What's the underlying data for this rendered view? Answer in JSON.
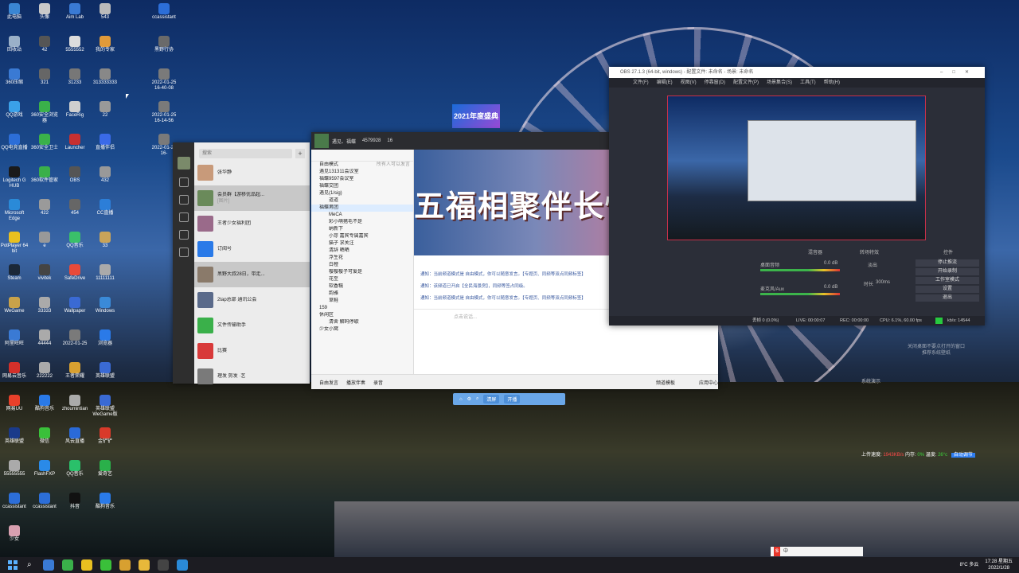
{
  "desktop_icons": [
    {
      "label": "此电脑",
      "color": "#3a86d4"
    },
    {
      "label": "头像",
      "color": "#c9c9c9"
    },
    {
      "label": "Aim Lab",
      "color": "#3a7ad4"
    },
    {
      "label": "543",
      "color": "#bbbbbb"
    },
    {
      "label": "ccassistant",
      "color": "#2c6ed8"
    },
    {
      "label": "回收站",
      "color": "#9ab0c8"
    },
    {
      "label": "42",
      "color": "#555555"
    },
    {
      "label": "5555552",
      "color": "#dddddd"
    },
    {
      "label": "我的专家",
      "color": "#e09a3a"
    },
    {
      "label": "黑野行协",
      "color": "#6a6a6a"
    },
    {
      "label": "360压缩",
      "color": "#3a7ad4"
    },
    {
      "label": "321",
      "color": "#666666"
    },
    {
      "label": "31233",
      "color": "#777777"
    },
    {
      "label": "313333333",
      "color": "#888888"
    },
    {
      "label": "2022-01-25 16-40-08",
      "color": "#7a7a7a"
    },
    {
      "label": "QQ游戏",
      "color": "#3aa0e8"
    },
    {
      "label": "360安全浏览器",
      "color": "#3ab04a"
    },
    {
      "label": "FaceRig",
      "color": "#cfcfcf"
    },
    {
      "label": "22",
      "color": "#999999"
    },
    {
      "label": "2022-01-25 16-14-56",
      "color": "#7a7a7a"
    },
    {
      "label": "QQ电竞直播",
      "color": "#2c6ed8"
    },
    {
      "label": "360安全卫士",
      "color": "#3ab04a"
    },
    {
      "label": "Launcher",
      "color": "#c83030"
    },
    {
      "label": "直播伴侣",
      "color": "#3a6ae8"
    },
    {
      "label": "2022-01-25 16-",
      "color": "#7a7a7a"
    },
    {
      "label": "Logitech G HUB",
      "color": "#1a1a1a"
    },
    {
      "label": "360软件管家",
      "color": "#3ab04a"
    },
    {
      "label": "OBS",
      "color": "#555555"
    },
    {
      "label": "432",
      "color": "#999999"
    },
    {
      "label": "Microsoft Edge",
      "color": "#2a8ad8"
    },
    {
      "label": "422",
      "color": "#9a9a9a"
    },
    {
      "label": "454",
      "color": "#666666"
    },
    {
      "label": "CC直播",
      "color": "#2c7ed8"
    },
    {
      "label": "PotPlayer 64 bit",
      "color": "#e8c020"
    },
    {
      "label": "e",
      "color": "#999999"
    },
    {
      "label": "QQ音乐",
      "color": "#3ac06a"
    },
    {
      "label": "33",
      "color": "#c9a45a"
    },
    {
      "label": "Steam",
      "color": "#1b2838"
    },
    {
      "label": "vivitek",
      "color": "#444444"
    },
    {
      "label": "SafeDrive",
      "color": "#e84a3a"
    },
    {
      "label": "11111111",
      "color": "#aaaaaa"
    },
    {
      "label": "WeGame",
      "color": "#c8a24a"
    },
    {
      "label": "33333",
      "color": "#aaaaaa"
    },
    {
      "label": "Wallpaper",
      "color": "#3a6ad4"
    },
    {
      "label": "Windows",
      "color": "#3a8ad8"
    },
    {
      "label": "阿里旺旺",
      "color": "#3a7ad4"
    },
    {
      "label": "44444",
      "color": "#aaaaaa"
    },
    {
      "label": "2022-01-25",
      "color": "#7a7a7a"
    },
    {
      "label": "浏览器",
      "color": "#2a7ae8"
    },
    {
      "label": "网易云音乐",
      "color": "#d4302a"
    },
    {
      "label": "222222",
      "color": "#aaaaaa"
    },
    {
      "label": "王者荣耀",
      "color": "#d8a030"
    },
    {
      "label": "英雄联盟",
      "color": "#3a6ad4"
    },
    {
      "label": "网易UU",
      "color": "#e8402a"
    },
    {
      "label": "酷狗音乐",
      "color": "#2a7ae8"
    },
    {
      "label": "zhoumintian",
      "color": "#aaaaaa"
    },
    {
      "label": "英雄联盟WeGame版",
      "color": "#3a6ad4"
    },
    {
      "label": "英雄联盟",
      "color": "#1a3a8a"
    },
    {
      "label": "微信",
      "color": "#3ac03a"
    },
    {
      "label": "风云直播",
      "color": "#2a6ad8"
    },
    {
      "label": "金铲铲",
      "color": "#d83a2a"
    },
    {
      "label": "55555555",
      "color": "#aaaaaa"
    },
    {
      "label": "FlashFXP",
      "color": "#2a8ae8"
    },
    {
      "label": "QQ音乐",
      "color": "#2ac06a"
    },
    {
      "label": "爱奇艺",
      "color": "#2ab04a"
    },
    {
      "label": "ccassistant",
      "color": "#2c6ed8"
    },
    {
      "label": "ccassistant",
      "color": "#2c6ed8"
    },
    {
      "label": "抖音",
      "color": "#111111"
    },
    {
      "label": "酷狗音乐",
      "color": "#2a7ae8"
    },
    {
      "label": "少女",
      "color": "#d8a0b0"
    }
  ],
  "banner_2021": "2021年度盛典",
  "wechat": {
    "search_placeholder": "搜索",
    "plus": "+",
    "chats": [
      {
        "title": "张华静",
        "preview": ""
      },
      {
        "title": "会员群【游移优品超...",
        "preview": "[图片]"
      },
      {
        "title": "王者少女福利团",
        "preview": ""
      },
      {
        "title": "订阅号",
        "preview": ""
      },
      {
        "title": "黑野大叔28日，带走...",
        "preview": ""
      },
      {
        "title": "2tap总部 通讯公会",
        "preview": ""
      },
      {
        "title": "文件传输助手",
        "preview": ""
      },
      {
        "title": "比赛",
        "preview": ""
      },
      {
        "title": "理发 剪发 ·艺",
        "preview": ""
      }
    ]
  },
  "yy": {
    "room_name": "遇见、福蝶",
    "room_id": "4579928",
    "users": "16",
    "mode": "自由模式",
    "manage": "所有人可以发言",
    "tree": [
      {
        "label": "遇见131311会议室",
        "level": 1
      },
      {
        "label": "福蝶9597会议室",
        "level": 1
      },
      {
        "label": "福蝶交团",
        "level": 1
      },
      {
        "label": "遇见(1/sig)",
        "level": 1
      },
      {
        "label": "道道",
        "level": 2
      },
      {
        "label": "福蝶男团",
        "level": 1,
        "current": true
      },
      {
        "label": "MeCA",
        "level": 2
      },
      {
        "label": "彩小萌猪毛不是",
        "level": 2
      },
      {
        "label": "纳新下",
        "level": 2
      },
      {
        "label": "小芽 嘉宾专属嘉宾",
        "level": 2
      },
      {
        "label": "猫子 求关注",
        "level": 2
      },
      {
        "label": "清辞 晒晒",
        "level": 2
      },
      {
        "label": "浮生花",
        "level": 2
      },
      {
        "label": "白橙",
        "level": 2
      },
      {
        "label": "樱樱樱子可爱是",
        "level": 2
      },
      {
        "label": "花至",
        "level": 2
      },
      {
        "label": "软香糯",
        "level": 2
      },
      {
        "label": "韵雅",
        "level": 2
      },
      {
        "label": "草鲑",
        "level": 2
      },
      {
        "label": "159",
        "level": 1
      },
      {
        "label": "休闲区",
        "level": 1
      },
      {
        "label": "清舍 解码停歇",
        "level": 2
      },
      {
        "label": "少女小窝",
        "level": 1
      }
    ],
    "banner_text": "五福相聚伴长情",
    "messages": [
      "通知：当前频道模式是 自由模式，你可以随意发言。【专题页、同频等双点同频标签】",
      "通知：该频道已开启【全民海景房】，同频等签占同级。",
      "通知：当前频道模式是 自由模式，你可以随意发言。【专题页、同频等双点同频标签】"
    ],
    "input_placeholder": "点击说话...",
    "bottom": [
      "自由发言",
      "播放伴奏",
      "录音",
      "频道模板",
      "应用中心"
    ]
  },
  "float_bar": {
    "btn1": "清屏",
    "btn2": "开播"
  },
  "obs": {
    "title": "OBS 27.1.3 (64-bit, windows) - 配置文件: 未命名 - 场景: 未命名",
    "menu": [
      "文件(F)",
      "编辑(E)",
      "视图(V)",
      "停靠窗(D)",
      "配置文件(P)",
      "场景集合(S)",
      "工具(T)",
      "帮助(H)"
    ],
    "docks": {
      "mixer": "混音器",
      "transitions": "转场特效",
      "controls": "控件"
    },
    "mixer_tracks": [
      "桌面音频",
      "麦克风/Aux"
    ],
    "db_values": [
      "0.0 dB",
      "0.0 dB"
    ],
    "transition": "淡出",
    "duration_label": "时长",
    "duration": "300ms",
    "buttons": [
      "停止推流",
      "开始录制",
      "工作室模式",
      "设置",
      "退出"
    ],
    "status": {
      "drop": "丢帧 0 (0.0%)",
      "live": "LIVE: 00:00:07",
      "rec": "REC: 00:00:00",
      "cpu": "CPU: 6.1%, 60.00 fps",
      "kbps": "kb/s: 14544"
    }
  },
  "watermark": {
    "line1": "关闭桌面不要点打开的窗口",
    "line2": "推荐系统壁纸"
  },
  "wm2": "系统演示",
  "netmon": {
    "up_label": "上传速度:",
    "up": "1943KB/s",
    "mem_label": "内存:",
    "mem": "0%",
    "temp_label": "温度:",
    "temp": "26°c",
    "btn": "自动调节"
  },
  "ime": {
    "logo": "S",
    "lang": "中"
  },
  "taskbar": {
    "weather": "8°C 多云",
    "time": "17:28 星期五",
    "date": "2022/1/28"
  }
}
